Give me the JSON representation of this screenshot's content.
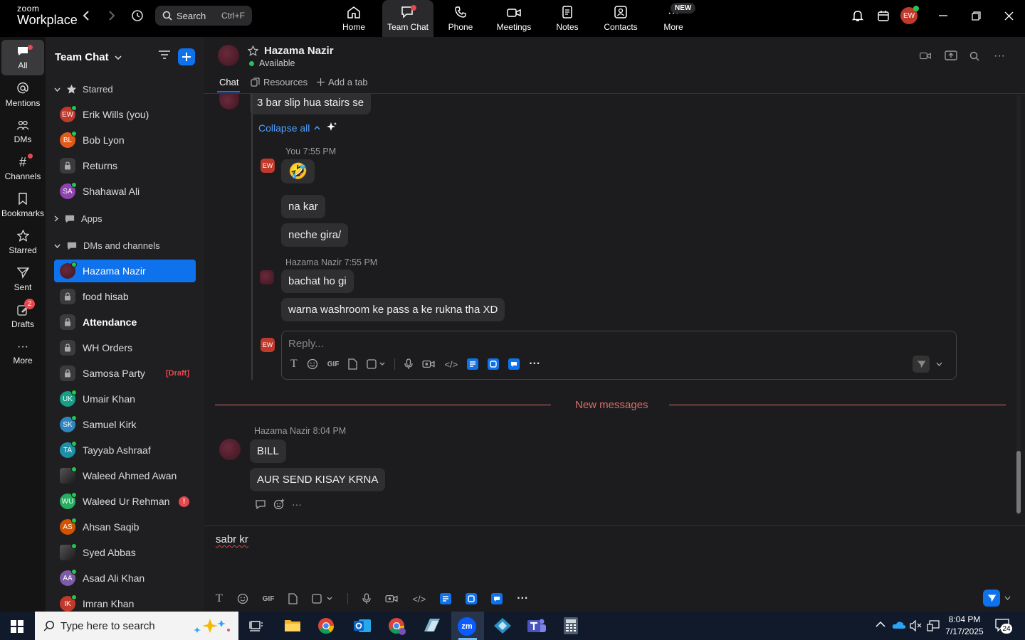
{
  "app": {
    "logo_small": "zoom",
    "logo_big": "Workplace"
  },
  "search": {
    "label": "Search",
    "shortcut": "Ctrl+F"
  },
  "topnav": [
    {
      "label": "Home",
      "icon": "home-icon"
    },
    {
      "label": "Team Chat",
      "icon": "chat-icon",
      "active": true
    },
    {
      "label": "Phone",
      "icon": "phone-icon"
    },
    {
      "label": "Meetings",
      "icon": "video-icon"
    },
    {
      "label": "Notes",
      "icon": "notes-icon"
    },
    {
      "label": "Contacts",
      "icon": "contacts-icon"
    },
    {
      "label": "More",
      "icon": "more-icon",
      "badge": "NEW"
    }
  ],
  "user": {
    "initials": "EW"
  },
  "rail": [
    {
      "label": "All"
    },
    {
      "label": "Mentions"
    },
    {
      "label": "DMs"
    },
    {
      "label": "Channels"
    },
    {
      "label": "Bookmarks"
    },
    {
      "label": "Starred"
    },
    {
      "label": "Sent"
    },
    {
      "label": "Drafts",
      "badge": "2"
    },
    {
      "label": "More"
    }
  ],
  "sidebar": {
    "title": "Team Chat",
    "starred_label": "Starred",
    "apps_label": "Apps",
    "dms_label": "DMs and channels",
    "starred": [
      {
        "name": "Erik Wills (you)",
        "initials": "EW",
        "color": "#c0392b"
      },
      {
        "name": "Bob Lyon",
        "initials": "BL",
        "color": "#e05a1b"
      },
      {
        "name": "Returns",
        "locked": true
      },
      {
        "name": "Shahawal Ali",
        "initials": "SA",
        "color": "#8e44ad"
      }
    ],
    "dms": [
      {
        "name": "Hazama Nazir",
        "selected": true
      },
      {
        "name": "food hisab",
        "locked": true
      },
      {
        "name": "Attendance",
        "locked": true,
        "bold": true
      },
      {
        "name": "WH Orders",
        "locked": true
      },
      {
        "name": "Samosa Party",
        "locked": true,
        "tag": "[Draft]"
      },
      {
        "name": "Umair Khan",
        "initials": "UK",
        "color": "#16a085"
      },
      {
        "name": "Samuel Kirk",
        "initials": "SK",
        "color": "#2e86c1"
      },
      {
        "name": "Tayyab Ashraaf",
        "initials": "TA",
        "color": "#1f8fa8"
      },
      {
        "name": "Waleed Ahmed Awan",
        "photo": true
      },
      {
        "name": "Waleed Ur Rehman",
        "initials": "WU",
        "color": "#27ae60",
        "alert": "!"
      },
      {
        "name": "Ahsan Saqib",
        "initials": "AS",
        "color": "#d35400"
      },
      {
        "name": "Syed Abbas",
        "photo": true
      },
      {
        "name": "Asad Ali Khan",
        "initials": "AA",
        "color": "#7d5ba6"
      },
      {
        "name": "Imran Khan",
        "initials": "IK",
        "color": "#c0392b"
      }
    ]
  },
  "chat": {
    "contact": "Hazama Nazir",
    "status": "Available",
    "tabs": [
      "Chat",
      "Resources",
      "Add a tab"
    ],
    "thread_top_msg": "3 bar slip hua stairs se",
    "collapse_label": "Collapse all",
    "you_label": "You",
    "you_time": "7:55 PM",
    "you_msgs": [
      "🤣",
      "na kar",
      "neche gira/"
    ],
    "hz_label": "Hazama Nazir",
    "hz_time": "7:55 PM",
    "hz_msgs": [
      "bachat ho gi",
      "warna washroom ke pass a ke rukna tha XD"
    ],
    "reply_placeholder": "Reply...",
    "new_messages_label": "New messages",
    "new_sender": "Hazama Nazir",
    "new_time": "8:04 PM",
    "new_msgs": [
      "BILL",
      "AUR SEND KISAY KRNA"
    ],
    "composer_text": "sabr kr"
  },
  "taskbar": {
    "search_placeholder": "Type here to search",
    "time": "8:04 PM",
    "date": "7/17/2025",
    "notif_count": "24"
  },
  "colors": {
    "accent": "#0e72ed",
    "alert": "#e5484d",
    "new_line": "#e06a6a"
  }
}
